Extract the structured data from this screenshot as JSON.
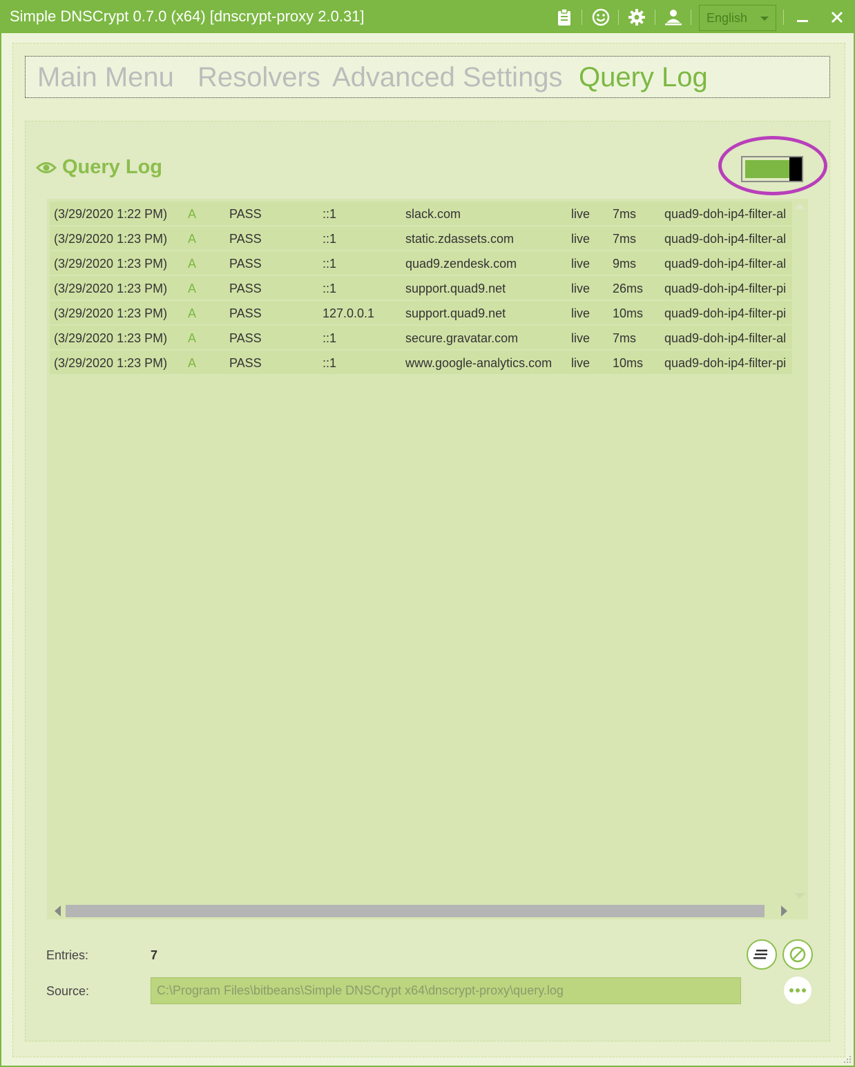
{
  "window": {
    "title": "Simple DNSCrypt 0.7.0 (x64) [dnscrypt-proxy 2.0.31]",
    "accent_color": "#7cb843",
    "toolbar_icons": [
      "clipboard-icon",
      "smiley-icon",
      "gear-icon",
      "person-icon"
    ],
    "language": "English"
  },
  "nav": {
    "tabs": [
      {
        "label": "Main Menu",
        "active": false
      },
      {
        "label": "Resolvers",
        "active": false
      },
      {
        "label": "Advanced Settings",
        "active": false
      },
      {
        "label": "Query Log",
        "active": true
      }
    ]
  },
  "querylog": {
    "title": "Query Log",
    "enabled": true,
    "highlight_color": "#b83fbb",
    "rows": [
      {
        "time": "(3/29/2020 1:22 PM)",
        "type": "A",
        "action": "PASS",
        "client": "::1",
        "domain": "slack.com",
        "status": "live",
        "duration": "7ms",
        "server": "quad9-doh-ip4-filter-al"
      },
      {
        "time": "(3/29/2020 1:23 PM)",
        "type": "A",
        "action": "PASS",
        "client": "::1",
        "domain": "static.zdassets.com",
        "status": "live",
        "duration": "7ms",
        "server": "quad9-doh-ip4-filter-al"
      },
      {
        "time": "(3/29/2020 1:23 PM)",
        "type": "A",
        "action": "PASS",
        "client": "::1",
        "domain": "quad9.zendesk.com",
        "status": "live",
        "duration": "9ms",
        "server": "quad9-doh-ip4-filter-al"
      },
      {
        "time": "(3/29/2020 1:23 PM)",
        "type": "A",
        "action": "PASS",
        "client": "::1",
        "domain": "support.quad9.net",
        "status": "live",
        "duration": "26ms",
        "server": "quad9-doh-ip4-filter-pi"
      },
      {
        "time": "(3/29/2020 1:23 PM)",
        "type": "A",
        "action": "PASS",
        "client": "127.0.0.1",
        "domain": "support.quad9.net",
        "status": "live",
        "duration": "10ms",
        "server": "quad9-doh-ip4-filter-pi"
      },
      {
        "time": "(3/29/2020 1:23 PM)",
        "type": "A",
        "action": "PASS",
        "client": "::1",
        "domain": "secure.gravatar.com",
        "status": "live",
        "duration": "7ms",
        "server": "quad9-doh-ip4-filter-al"
      },
      {
        "time": "(3/29/2020 1:23 PM)",
        "type": "A",
        "action": "PASS",
        "client": "::1",
        "domain": "www.google-analytics.com",
        "status": "live",
        "duration": "10ms",
        "server": "quad9-doh-ip4-filter-pi"
      }
    ]
  },
  "footer": {
    "entries_label": "Entries:",
    "entries_value": "7",
    "source_label": "Source:",
    "source_value": "C:\\Program Files\\bitbeans\\Simple DNSCrypt x64\\dnscrypt-proxy\\query.log"
  }
}
